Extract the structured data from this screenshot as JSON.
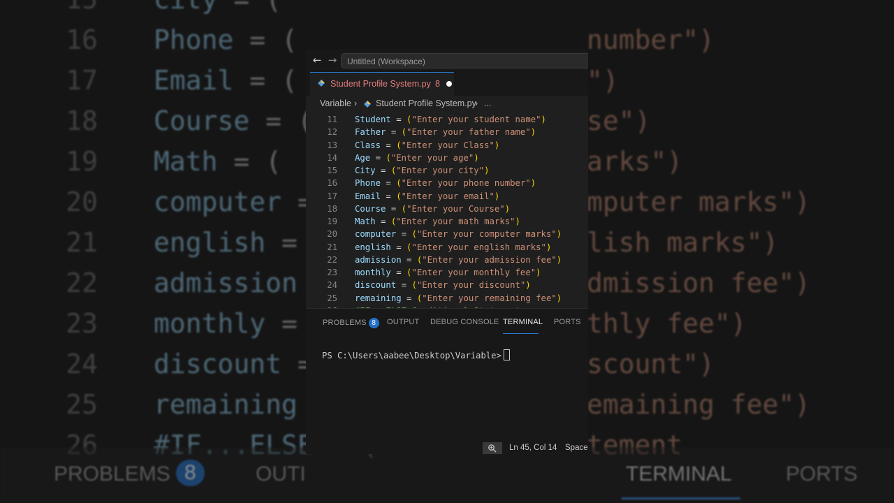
{
  "window": {
    "title": "Untitled (Workspace)"
  },
  "tab": {
    "label": "Student Profile System.py",
    "problem_count": "8"
  },
  "breadcrumb": {
    "folder": "Variable",
    "file": "Student Profile System.py",
    "more": "..."
  },
  "editor": {
    "lines": [
      {
        "num": "11",
        "var": "Student",
        "str": "\"Enter your student name\""
      },
      {
        "num": "12",
        "var": "Father",
        "str": "\"Enter your father name\""
      },
      {
        "num": "13",
        "var": "Class",
        "str": "\"Enter your Class\""
      },
      {
        "num": "14",
        "var": "Age",
        "str": "\"Enter your age\""
      },
      {
        "num": "15",
        "var": "City",
        "str": "\"Enter your city\""
      },
      {
        "num": "16",
        "var": "Phone",
        "str": "\"Enter your phone number\""
      },
      {
        "num": "17",
        "var": "Email",
        "str": "\"Enter your email\""
      },
      {
        "num": "18",
        "var": "Course",
        "str": "\"Enter your Course\""
      },
      {
        "num": "19",
        "var": "Math",
        "str": "\"Enter your math marks\""
      },
      {
        "num": "20",
        "var": "computer",
        "str": "\"Enter your computer marks\""
      },
      {
        "num": "21",
        "var": "english",
        "str": "\"Enter your english marks\""
      },
      {
        "num": "22",
        "var": "admission",
        "str": "\"Enter your admission fee\""
      },
      {
        "num": "23",
        "var": "monthly",
        "str": "\"Enter your monthly fee\""
      },
      {
        "num": "24",
        "var": "discount",
        "str": "\"Enter your discount\""
      },
      {
        "num": "25",
        "var": "remaining",
        "str": "\"Enter your remaining fee\""
      }
    ],
    "partial_line": {
      "num": "26",
      "comment": "#IF...ELSE Conditional Statement"
    }
  },
  "panel": {
    "tabs": [
      "PROBLEMS",
      "OUTPUT",
      "DEBUG CONSOLE",
      "TERMINAL",
      "PORTS"
    ],
    "problems_badge": "8",
    "active_tab": "TERMINAL",
    "prompt": "PS C:\\Users\\aabee\\Desktop\\Variable>"
  },
  "status": {
    "position": "Ln 45, Col 14",
    "spaces": "Spaces"
  },
  "background": {
    "lines": [
      {
        "num": "15",
        "var": "city",
        "right": ""
      },
      {
        "num": "16",
        "var": "Phone",
        "right": "number\")"
      },
      {
        "num": "17",
        "var": "Email",
        "right": "\")"
      },
      {
        "num": "18",
        "var": "Course",
        "right": "se\")"
      },
      {
        "num": "19",
        "var": "Math",
        "right": "arks\")"
      },
      {
        "num": "20",
        "var": "computer",
        "right": "mputer marks\")"
      },
      {
        "num": "21",
        "var": "english",
        "right": "lish marks\")"
      },
      {
        "num": "22",
        "var": "admission",
        "right": "dmission fee\")"
      },
      {
        "num": "23",
        "var": "monthly",
        "right": "thly fee\")"
      },
      {
        "num": "24",
        "var": "discount",
        "right": "scount\")"
      },
      {
        "num": "25",
        "var": "remaining",
        "right": "emaining fee\")"
      },
      {
        "num": "26",
        "var": "#IF...ELSE",
        "right": "tement"
      }
    ],
    "bottom_left": "PROBLEMS",
    "bottom_badge": "8",
    "bottom_mid": "OUTI",
    "bottom_terminal": "TERMINAL",
    "bottom_ports": "PORTS"
  }
}
